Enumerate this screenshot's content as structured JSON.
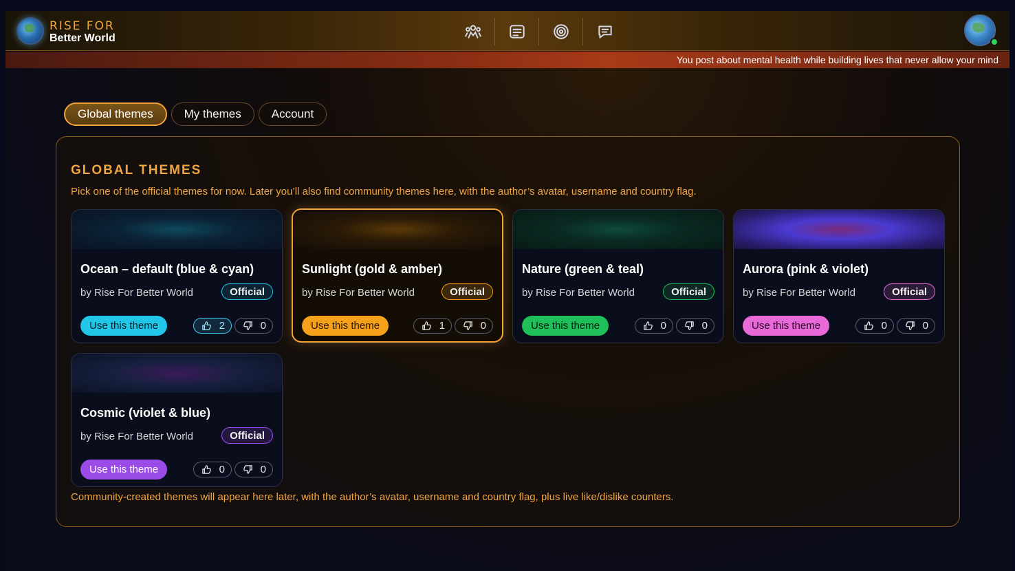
{
  "header": {
    "brand_top": "RISE FOR",
    "brand_bottom": "Better World",
    "nav_icons": [
      "community-icon",
      "feed-icon",
      "target-icon",
      "chat-icon"
    ]
  },
  "ticker": {
    "text": "You post about mental health while building lives that never allow your mind"
  },
  "tabs": [
    {
      "label": "Global themes",
      "active": true
    },
    {
      "label": "My themes",
      "active": false
    },
    {
      "label": "Account",
      "active": false
    }
  ],
  "panel": {
    "title": "GLOBAL THEMES",
    "subtitle": "Pick one of the official themes for now. Later you’ll also find community themes here, with the author’s avatar, username and country flag.",
    "footnote": "Community-created themes will appear here later, with the author’s avatar, username and country flag, plus live like/dislike counters."
  },
  "themes": [
    {
      "name": "Ocean – default (blue & cyan)",
      "author": "by Rise For Better World",
      "badge": "Official",
      "use_label": "Use this theme",
      "likes": "2",
      "dislikes": "0",
      "accent": "#22c7e8",
      "selected": false,
      "liked": true
    },
    {
      "name": "Sunlight (gold & amber)",
      "author": "by Rise For Better World",
      "badge": "Official",
      "use_label": "Use this theme",
      "likes": "1",
      "dislikes": "0",
      "accent": "#f5a11a",
      "selected": true,
      "liked": false
    },
    {
      "name": "Nature (green & teal)",
      "author": "by Rise For Better World",
      "badge": "Official",
      "use_label": "Use this theme",
      "likes": "0",
      "dislikes": "0",
      "accent": "#1fbf5a",
      "selected": false,
      "liked": false
    },
    {
      "name": "Aurora (pink & violet)",
      "author": "by Rise For Better World",
      "badge": "Official",
      "use_label": "Use this theme",
      "likes": "0",
      "dislikes": "0",
      "accent": "#e86ad8",
      "selected": false,
      "liked": false
    },
    {
      "name": "Cosmic (violet & blue)",
      "author": "by Rise For Better World",
      "badge": "Official",
      "use_label": "Use this theme",
      "likes": "0",
      "dislikes": "0",
      "accent": "#9b4be8",
      "selected": false,
      "liked": false
    }
  ]
}
